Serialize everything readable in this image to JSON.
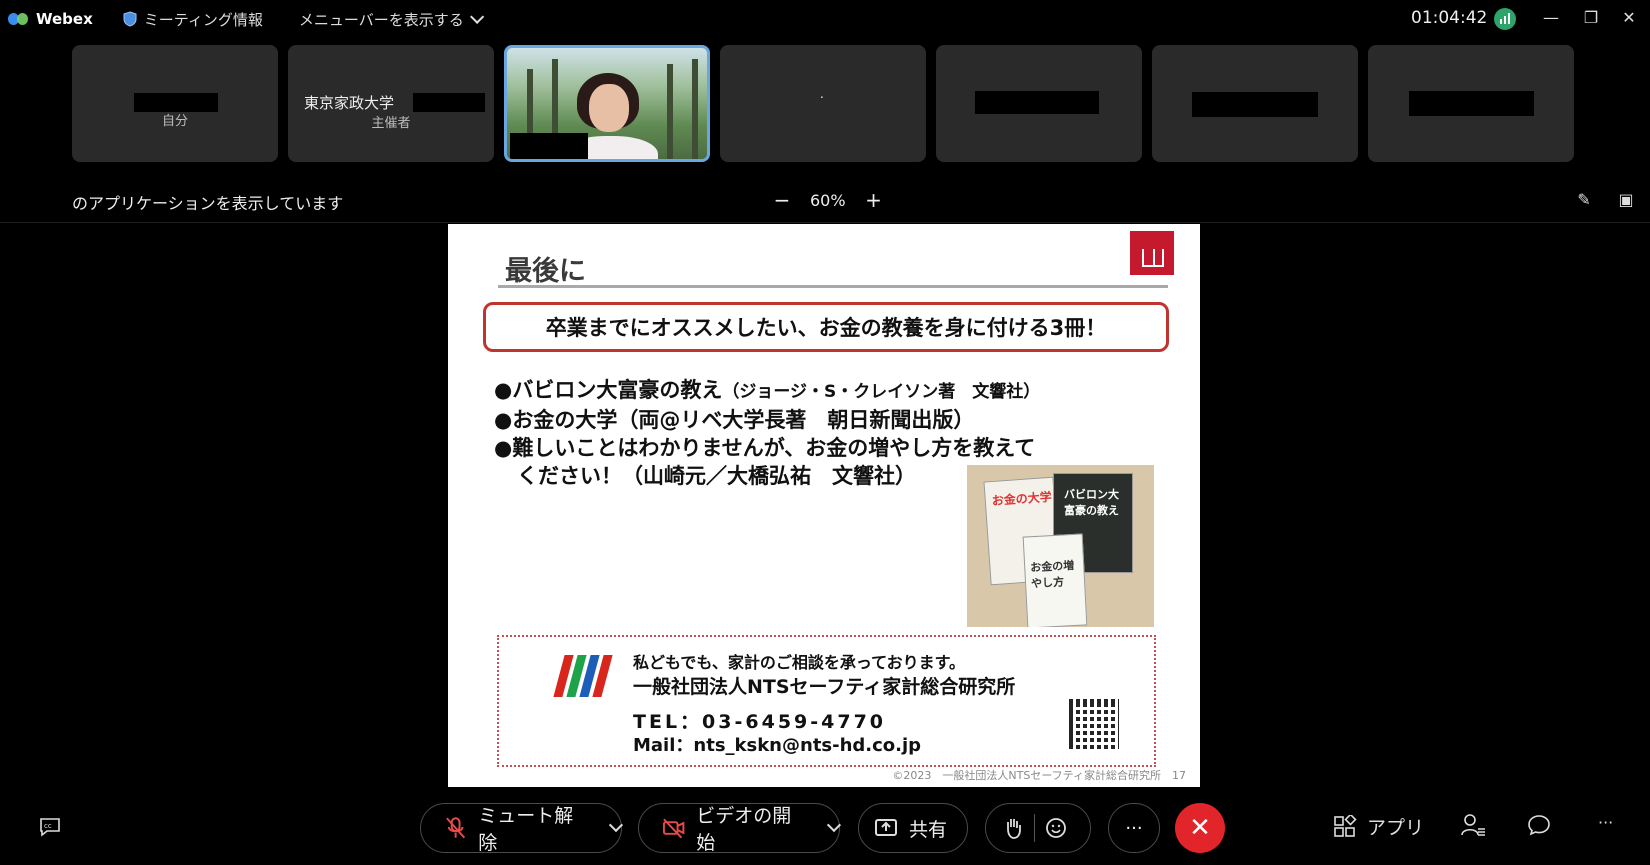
{
  "app": {
    "name": "Webex"
  },
  "titlebar": {
    "meeting_info": "ミーティング情報",
    "menu_toggle": "メニューバーを表示する",
    "timer": "01:04:42",
    "minimize": "—",
    "restore": "❐",
    "close": "✕"
  },
  "participants": [
    {
      "name": "",
      "subtitle": "自分"
    },
    {
      "name": "東京家政大学",
      "subtitle": "主催者"
    },
    {
      "name": "",
      "subtitle": ""
    },
    {
      "name": ".",
      "subtitle": ""
    },
    {
      "name": "",
      "subtitle": ""
    },
    {
      "name": "",
      "subtitle": ""
    },
    {
      "name": "",
      "subtitle": ""
    }
  ],
  "share_bar": {
    "text": "のアプリケーションを表示しています",
    "zoom_minus": "−",
    "zoom_value": "60%",
    "zoom_plus": "+"
  },
  "slide": {
    "title": "最後に",
    "sdg_text": "4 質の高い教育をみんなに",
    "headline": "卒業までにオススメしたい、お金の教養を身に付ける3冊！",
    "bullets": [
      {
        "main": "●バビロン大富豪の教え",
        "note": "（ジョージ・S・クレイソン著　文響社）"
      },
      {
        "main": "●お金の大学（両@リベ大学長著　朝日新聞出版）"
      },
      {
        "main": "●難しいことはわかりませんが、お金の増やし方を教えて",
        "cont": "ください！（山崎元／大橋弘祐　文響社）"
      }
    ],
    "book_labels": [
      "お金の大学",
      "バビロン大富豪の教え",
      "お金の増やし方"
    ],
    "contact": {
      "line1": "私どもでも、家計のご相談を承っております。",
      "org": "一般社団法人NTSセーフティ家計総合研究所",
      "tel": "TEL：03-6459-4770",
      "mail": "Mail：nts_kskn@nts-hd.co.jp"
    },
    "copyright": "©2023　一般社団法人NTSセーフティ家計総合研究所　17"
  },
  "controls": {
    "mute": "ミュート解除",
    "video": "ビデオの開始",
    "share": "共有",
    "more": "···",
    "end": "✕",
    "apps": "アプリ",
    "overflow": "···"
  },
  "colors": {
    "end_button": "#e2252b",
    "headline_border": "#c0342f",
    "sdg": "#c5192d"
  }
}
